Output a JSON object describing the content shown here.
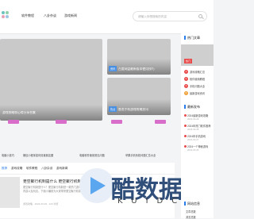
{
  "header": {
    "nav": [
      "软件教程",
      "八卦杂谈",
      "游戏新闻"
    ],
    "search_placeholder": "请输入你想搜索的内容"
  },
  "hero": {
    "main_caption": "游戏攻略和心得分享合集",
    "card_right_top": {
      "tag": "资讯",
      "caption": "百度网盘最新版本使用技巧"
    },
    "card_right_bottom": {
      "tag": "热点",
      "caption": "各类手机游戏攻略资讯"
    }
  },
  "grid_links": [
    "电脑小技巧",
    "微信小程序如何设置朋友圈",
    "电脑软件使用常见问题",
    "苹果手机系统问题汇总大全"
  ],
  "tabs": [
    "推荐",
    "游戏攻略",
    "软件教程",
    "八卦杂谈",
    "游戏新闻"
  ],
  "article": {
    "title": "更空聚行机制是什么 更空聚行机制介绍",
    "description": "更空聚行机制是什么？更空聚行机制是一款热门游戏中的重要机制，很多玩家都想了解更空聚行机制的具体内容以及玩法，下面小编就为大家带来更空聚行机制的详细介绍。",
    "meta": "游戏攻略 · 2024-03-29 · 123 浏览"
  },
  "watermark": {
    "brand": "酷数据",
    "sub": "KUIDC"
  },
  "sidebar": {
    "hot_title": "热门文章",
    "hot_badge": "热门",
    "ranked": [
      "游戏攻略汇总",
      "软件使用教程",
      "手机问题大全",
      "最新游戏资讯"
    ],
    "latest_title": "最新发布",
    "latest": [
      {
        "title": "2024最新游戏攻略",
        "date": "2024-03-29"
      },
      {
        "title": "2024年热门软件推荐",
        "date": "2024-03-28"
      },
      {
        "title": "2024年手机游戏",
        "date": "2024-03-27"
      },
      {
        "title": "2024一个神秘游戏",
        "date": "2024-03-26"
      }
    ],
    "stats_title": "网站信息",
    "stats": [
      "文章总数",
      "浏览总数"
    ]
  },
  "colors": {
    "accent": "#2b7de9",
    "pill": "#d86ec9",
    "hot": "#e94a4a"
  }
}
